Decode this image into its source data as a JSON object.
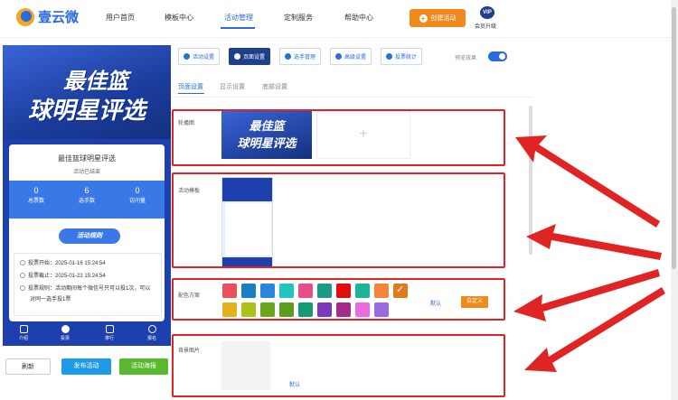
{
  "app": {
    "name": "壹云微"
  },
  "nav": {
    "items": [
      "用户首页",
      "模板中心",
      "活动管理",
      "定制服务",
      "帮助中心"
    ],
    "active": "活动管理",
    "create_button": "创建活动",
    "vip_badge": "VIP",
    "vip_label": "会员升级"
  },
  "preview": {
    "banner_line1": "最佳篮",
    "banner_line2": "球明星评选",
    "title": "最佳篮球明星评选",
    "status": "活动已结束",
    "stats": [
      {
        "value": "0",
        "label": "总票数"
      },
      {
        "value": "6",
        "label": "选手数"
      },
      {
        "value": "0",
        "label": "访问量"
      }
    ],
    "rules_label": "活动规则",
    "info": {
      "vote_start": "投票开始：2025-01-16 15:24:54",
      "vote_end": "投票截止：2025-01-22 15:24:54",
      "vote_rule_1": "投票规则：活动期间每个微信号只可以投1次，可以",
      "vote_rule_2": "对同一选手投1票"
    },
    "tabbar": [
      "介绍",
      "投票",
      "排行",
      "报名"
    ]
  },
  "footer_buttons": {
    "refresh": "刷新",
    "publish": "发布活动",
    "poster": "活动海报"
  },
  "toolbar": {
    "buttons": [
      "活动设置",
      "页面设置",
      "选手管理",
      "高级设置",
      "投票统计"
    ],
    "active": "页面设置",
    "preview_toggle_label": "预览效果",
    "preview_toggle_on": true
  },
  "subtabs": {
    "items": [
      "页面设置",
      "显示设置",
      "底部设置"
    ],
    "active": "页面设置"
  },
  "sections": {
    "carousel": {
      "label": "轮播图",
      "add_symbol": "+",
      "thumb_line1": "最佳篮",
      "thumb_line2": "球明星评选"
    },
    "template": {
      "label": "活动模板"
    },
    "color_scheme": {
      "label": "配色方案",
      "default_button": "默认",
      "custom_button": "自定义",
      "swatches_row1": [
        "#e8505b",
        "#1b7fc4",
        "#2a87e0",
        "#22c5c0",
        "#e64f8c",
        "#1a9a89",
        "#e00f0f",
        "#1bb59a",
        "#f5843a",
        "#e07a1c"
      ],
      "swatches_row2": [
        "#e0b31c",
        "#a9c21c",
        "#6aa51c",
        "#5a9e1c",
        "#159a77",
        "#7a3ac0",
        "#a52b8a",
        "#ea6ae0",
        "#9a6ae0"
      ],
      "selected_index": 9
    },
    "background": {
      "label": "背景图片",
      "default_button": "默认"
    }
  },
  "colors": {
    "primary": "#2a6be0",
    "navy": "#1d3f8c",
    "accent_orange": "#f08a1c",
    "annotation_red": "#e02424",
    "publish_blue": "#1e9be8",
    "poster_green": "#59b82e"
  }
}
